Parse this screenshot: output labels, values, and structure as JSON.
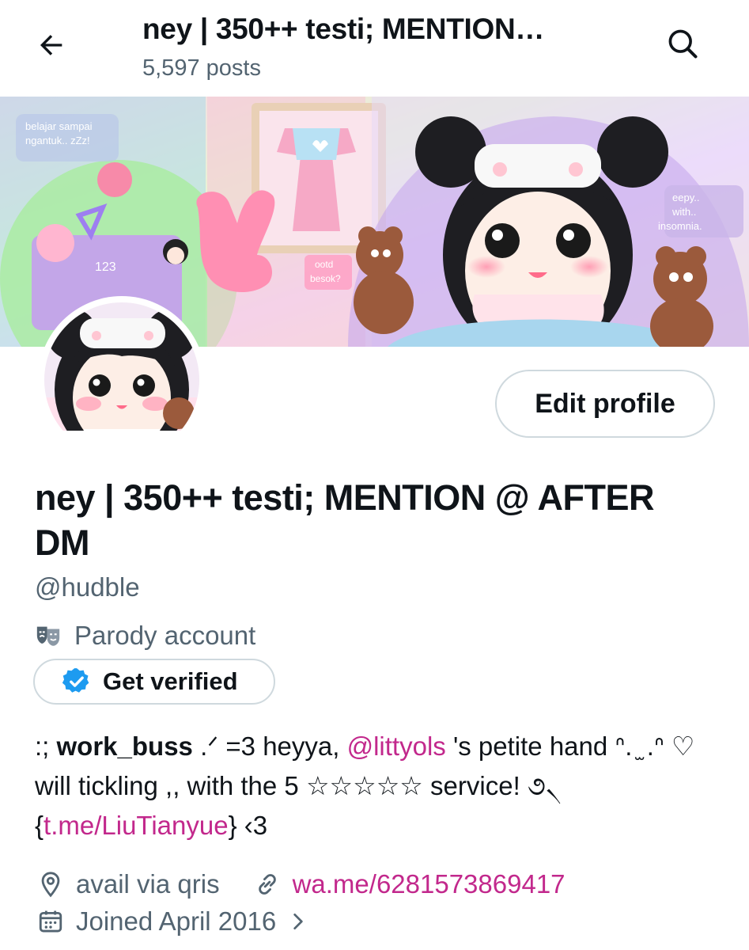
{
  "header": {
    "title": "ney | 350++ testi; MENTION…",
    "posts": "5,597 posts",
    "back_icon": "arrow-left-icon",
    "search_icon": "search-icon"
  },
  "banner": {
    "text_top_left_1": "belajar sampai",
    "text_top_left_2": "ngantuk.. zZz!",
    "text_mid": "ootd",
    "text_mid_2": "besok?",
    "text_right_1": "eepy..",
    "text_right_2": "with..",
    "text_right_3": "insomnia.",
    "text_card": "123"
  },
  "profile": {
    "edit_button": "Edit profile",
    "display_name": "ney | 350++ testi; MENTION @ AFTER DM",
    "handle": "@hudble",
    "parody_label": "Parody account",
    "get_verified": "Get verified",
    "bio": {
      "part1": ":; ",
      "bold": "work_buss",
      "part2": " .ᐟ =3 heyya, ",
      "mention": "@littyols",
      "part3": " 's petite hand ᐢ. ̫ .ᐢ ♡ will tickling ,, with the 5 ☆☆☆☆☆ service! ૭৲ {",
      "link": "t.me/LiuTianyue",
      "part4": "} ‹3"
    },
    "location": "avail via qris",
    "website": "wa.me/6281573869417",
    "joined": "Joined April 2016"
  },
  "colors": {
    "accent_link": "#c2288c",
    "secondary_text": "#536471",
    "primary_text": "#0f1419",
    "verified_blue": "#1d9bf0",
    "border": "#cfd9de"
  }
}
